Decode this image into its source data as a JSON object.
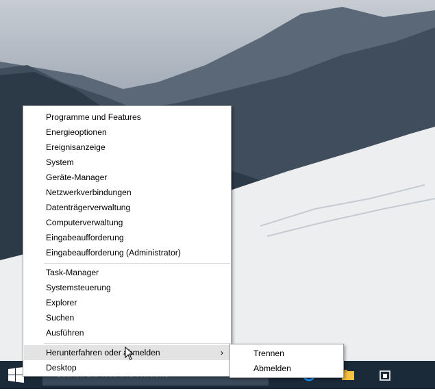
{
  "taskbar": {
    "search_placeholder": "Suchen Sie Web und Windows",
    "icons": [
      "windows-logo-icon",
      "edge-ie-icon",
      "file-explorer-icon",
      "store-icon"
    ]
  },
  "context_menu": {
    "group1": [
      "Programme und Features",
      "Energieoptionen",
      "Ereignisanzeige",
      "System",
      "Geräte-Manager",
      "Netzwerkverbindungen",
      "Datenträgerverwaltung",
      "Computerverwaltung",
      "Eingabeaufforderung",
      "Eingabeaufforderung (Administrator)"
    ],
    "group2": [
      "Task-Manager",
      "Systemsteuerung",
      "Explorer",
      "Suchen",
      "Ausführen"
    ],
    "group3": [
      "Herunterfahren oder abmelden",
      "Desktop"
    ],
    "submenu_arrow": "›"
  },
  "submenu": {
    "items": [
      "Trennen",
      "Abmelden"
    ]
  },
  "colors": {
    "taskbar": "#1b2a38",
    "menu_bg": "#ffffff",
    "hover": "#e3e3e3"
  }
}
